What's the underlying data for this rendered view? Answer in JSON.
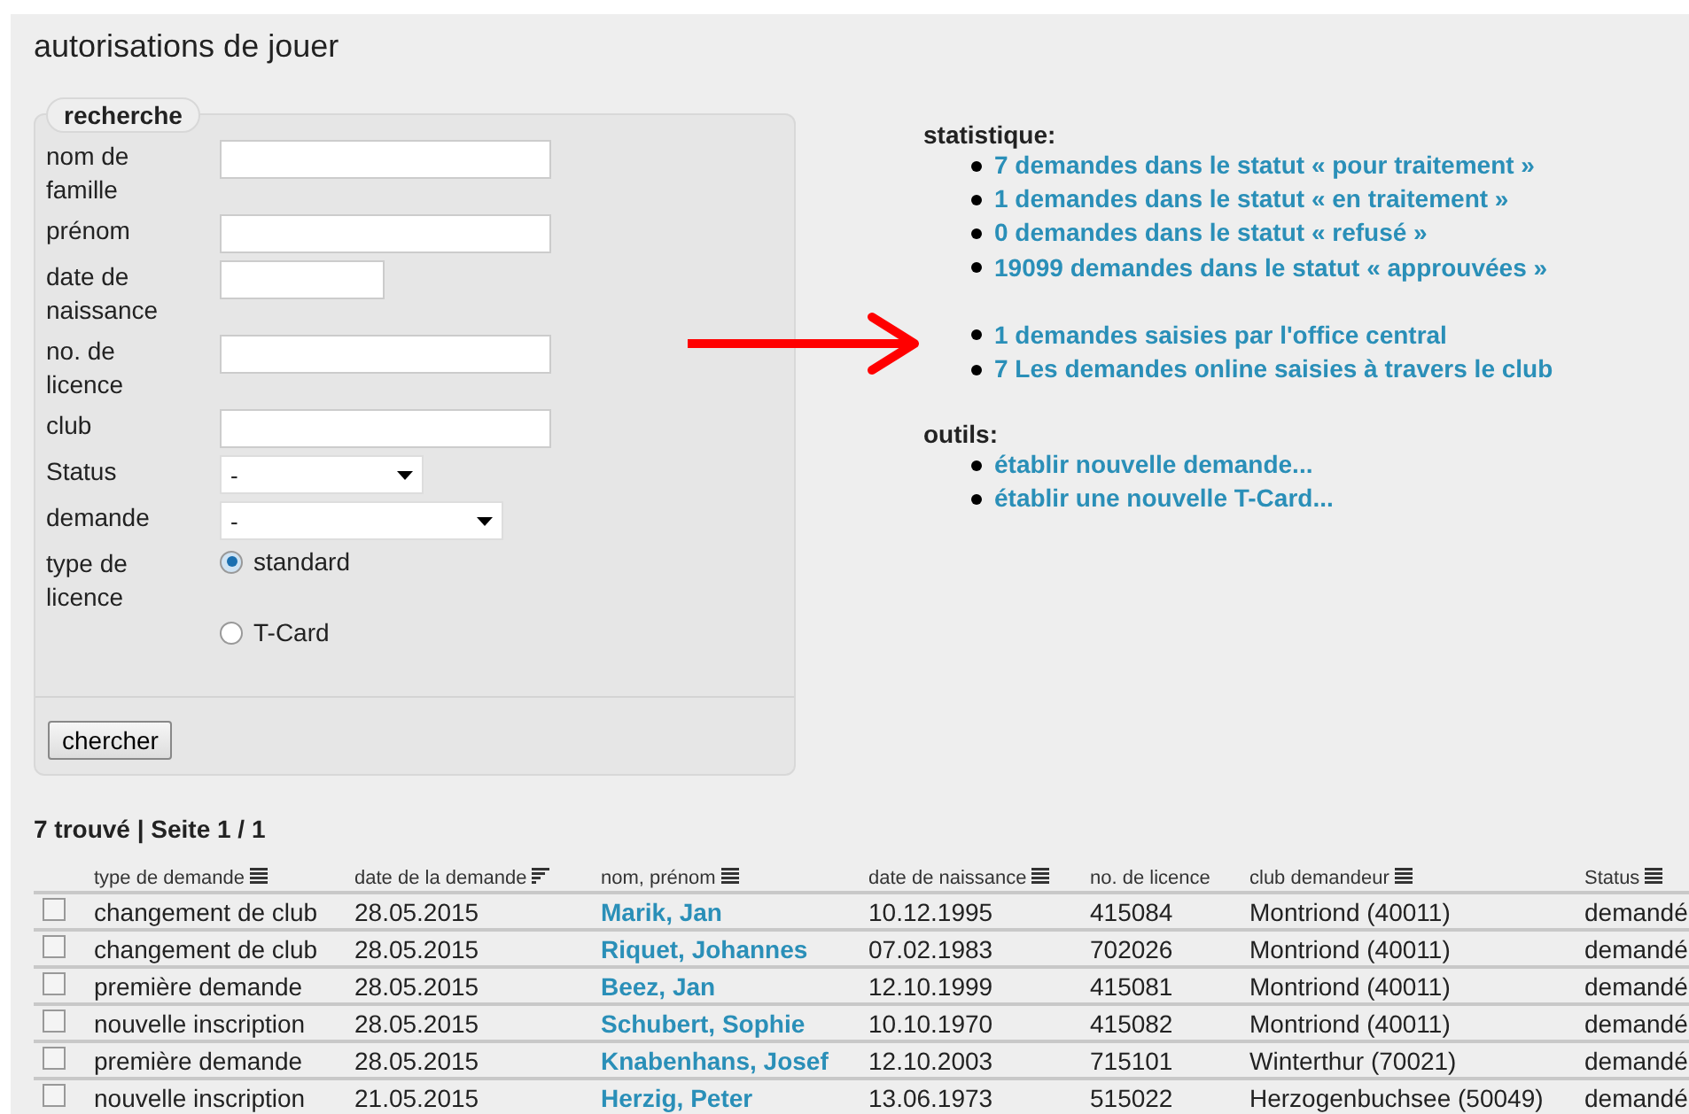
{
  "page_title": "autorisations de jouer",
  "search": {
    "legend": "recherche",
    "fields": [
      {
        "kind": "text",
        "label": "nom de famille"
      },
      {
        "kind": "text",
        "label": "prénom"
      },
      {
        "kind": "text",
        "label": "date de naissance"
      },
      {
        "kind": "text",
        "label": "no. de licence"
      },
      {
        "kind": "text",
        "label": "club"
      },
      {
        "kind": "select",
        "label": "Status",
        "value": "-"
      },
      {
        "kind": "select",
        "label": "demande",
        "value": "-"
      },
      {
        "kind": "radio",
        "label": "type de licence",
        "options": [
          {
            "label": "standard",
            "selected": true
          },
          {
            "label": "T-Card",
            "selected": false
          }
        ]
      }
    ],
    "button": "chercher"
  },
  "statistics": {
    "title": "statistique:",
    "groups": [
      [
        "7 demandes dans le statut « pour traitement »",
        "1 demandes dans le statut « en traitement »",
        "0 demandes dans le statut « refusé »",
        "19099 demandes dans le statut « approuvées »"
      ],
      [
        "1 demandes saisies par l'office central",
        "7 Les demandes online saisies à travers le club"
      ]
    ]
  },
  "tools": {
    "title": "outils:",
    "links": [
      "établir nouvelle demande...",
      "établir une nouvelle T-Card..."
    ]
  },
  "results": {
    "summary": "7 trouvé | Seite 1 / 1",
    "columns": [
      {
        "label": "type de demande",
        "sortable": true,
        "sorted": false
      },
      {
        "label": "date de la demande",
        "sortable": true,
        "sorted": true
      },
      {
        "label": "nom, prénom",
        "sortable": true,
        "sorted": false
      },
      {
        "label": "date de naissance",
        "sortable": true,
        "sorted": false
      },
      {
        "label": "no. de licence",
        "sortable": false
      },
      {
        "label": "club demandeur",
        "sortable": true,
        "sorted": false
      },
      {
        "label": "Status",
        "sortable": true,
        "sorted": false
      }
    ],
    "rows": [
      {
        "checked": false,
        "cells": [
          "changement de club",
          "28.05.2015",
          "Marik, Jan",
          "10.12.1995",
          "415084",
          "Montriond (40011)",
          "demandé"
        ]
      },
      {
        "checked": false,
        "cells": [
          "changement de club",
          "28.05.2015",
          "Riquet, Johannes",
          "07.02.1983",
          "702026",
          "Montriond (40011)",
          "demandé"
        ]
      },
      {
        "checked": false,
        "cells": [
          "première demande",
          "28.05.2015",
          "Beez, Jan",
          "12.10.1999",
          "415081",
          "Montriond (40011)",
          "demandé"
        ]
      },
      {
        "checked": false,
        "cells": [
          "nouvelle inscription",
          "28.05.2015",
          "Schubert, Sophie",
          "10.10.1970",
          "415082",
          "Montriond (40011)",
          "demandé"
        ]
      },
      {
        "checked": false,
        "cells": [
          "première demande",
          "28.05.2015",
          "Knabenhans, Josef",
          "12.10.2003",
          "715101",
          "Winterthur (70021)",
          "demandé"
        ]
      },
      {
        "checked": false,
        "cells": [
          "nouvelle inscription",
          "21.05.2015",
          "Herzig, Peter",
          "13.06.1973",
          "515022",
          "Herzogenbuchsee (50049)",
          "demandé"
        ]
      }
    ]
  }
}
